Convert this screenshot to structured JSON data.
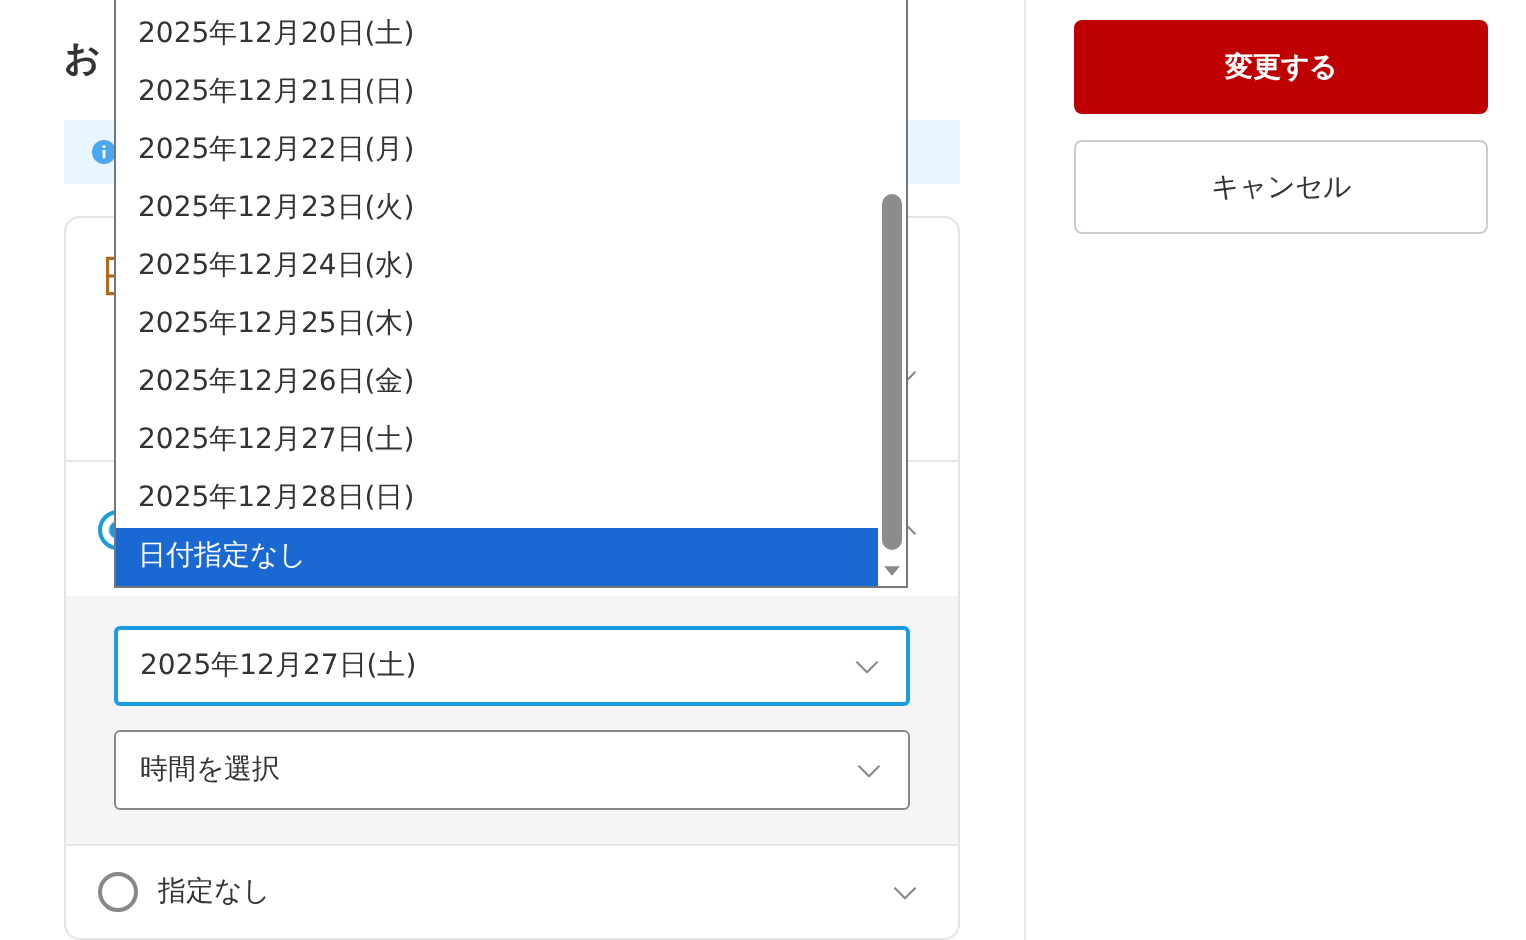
{
  "heading": "お",
  "info_bar": {
    "kind": "info"
  },
  "delivery_options": [
    {
      "kind": "icon",
      "expanded": false
    },
    {
      "kind": "radio",
      "selected": true,
      "expanded": true,
      "date_select": {
        "value": "2025年12月27日(土)",
        "focused": true
      },
      "time_select": {
        "value": "時間を選択",
        "focused": false
      }
    },
    {
      "kind": "radio",
      "label": "指定なし",
      "selected": false,
      "expanded": false
    }
  ],
  "date_dropdown": {
    "options": [
      {
        "label": "2025年12月20日(土)",
        "selected": false
      },
      {
        "label": "2025年12月21日(日)",
        "selected": false
      },
      {
        "label": "2025年12月22日(月)",
        "selected": false
      },
      {
        "label": "2025年12月23日(火)",
        "selected": false
      },
      {
        "label": "2025年12月24日(水)",
        "selected": false
      },
      {
        "label": "2025年12月25日(木)",
        "selected": false
      },
      {
        "label": "2025年12月26日(金)",
        "selected": false
      },
      {
        "label": "2025年12月27日(土)",
        "selected": false
      },
      {
        "label": "2025年12月28日(日)",
        "selected": false
      },
      {
        "label": "日付指定なし",
        "selected": true
      }
    ]
  },
  "buttons": [
    {
      "kind": "primary",
      "label": "変更する"
    },
    {
      "kind": "secondary",
      "label": "キャンセル"
    }
  ]
}
